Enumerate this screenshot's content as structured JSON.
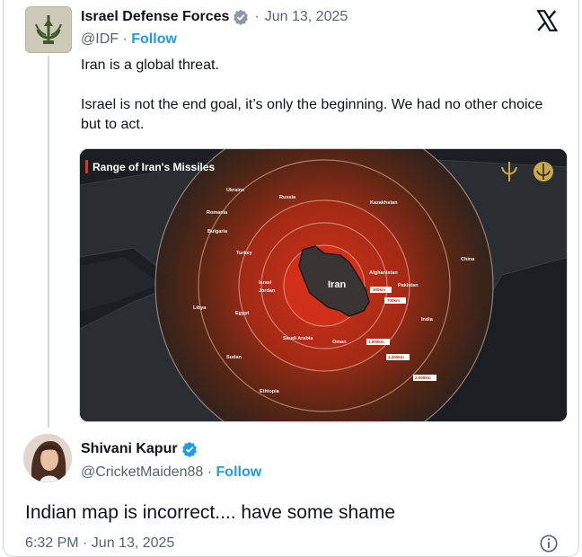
{
  "quoted_tweet": {
    "author_name": "Israel Defense Forces",
    "date": "Jun 13, 2025",
    "handle": "@IDF",
    "follow_label": "Follow",
    "text": "Iran is a global threat.\n\nIsrael is not the end goal, it’s only the beginning. We had no other choice but to act.",
    "media": {
      "title": "Range of Iran's Missiles",
      "center_label": "Iran",
      "country_labels": [
        "Ukraine",
        "Russia",
        "Kazakhstan",
        "Romania",
        "Bulgaria",
        "Turkey",
        "China",
        "Afghanistan",
        "Pakistan",
        "Israel",
        "Jordan",
        "Libya",
        "Egypt",
        "India",
        "Saudi Arabia",
        "Oman",
        "Sudan",
        "Ethiopia"
      ],
      "range_labels": [
        "300km",
        "700km",
        "1,000km",
        "1,300km",
        "2,000km"
      ]
    }
  },
  "reply": {
    "author_name": "Shivani Kapur",
    "handle": "@CricketMaiden88",
    "follow_label": "Follow",
    "text": "Indian map is incorrect.... have some shame",
    "timestamp": "6:32 PM · Jun 13, 2025"
  },
  "colors": {
    "verified": "#1d9bf0",
    "link": "#1d9bf0",
    "secondary_text": "#536471",
    "heat_center": "#d42c14"
  },
  "icons": [
    "idf-logo-icon",
    "verified-badge-icon",
    "x-logo-icon",
    "info-icon"
  ]
}
